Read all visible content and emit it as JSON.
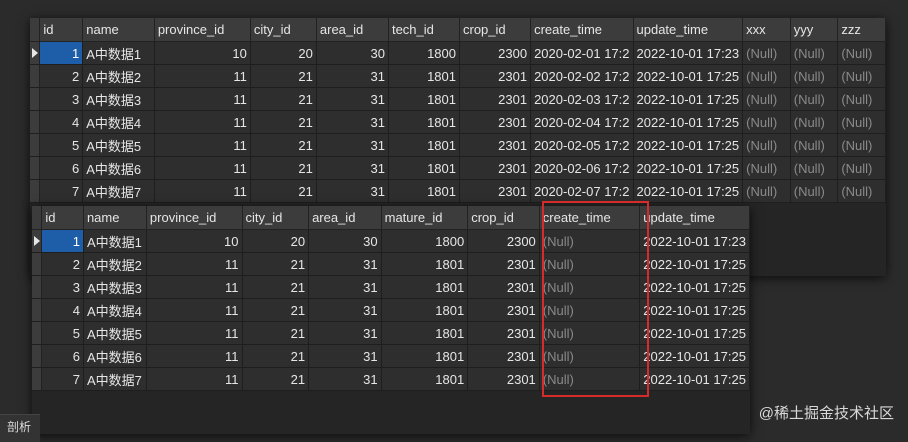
{
  "grid1": {
    "columns": [
      "id",
      "name",
      "province_id",
      "city_id",
      "area_id",
      "tech_id",
      "crop_id",
      "create_time",
      "update_time",
      "xxx",
      "yyy",
      "zzz"
    ],
    "rows": [
      [
        "1",
        "A中数据1",
        "10",
        "20",
        "30",
        "1800",
        "2300",
        "2020-02-01 17:2",
        "2022-10-01 17:23",
        "(Null)",
        "(Null)",
        "(Null)"
      ],
      [
        "2",
        "A中数据2",
        "11",
        "21",
        "31",
        "1801",
        "2301",
        "2020-02-02 17:2",
        "2022-10-01 17:25",
        "(Null)",
        "(Null)",
        "(Null)"
      ],
      [
        "3",
        "A中数据3",
        "11",
        "21",
        "31",
        "1801",
        "2301",
        "2020-02-03 17:2",
        "2022-10-01 17:25",
        "(Null)",
        "(Null)",
        "(Null)"
      ],
      [
        "4",
        "A中数据4",
        "11",
        "21",
        "31",
        "1801",
        "2301",
        "2020-02-04 17:2",
        "2022-10-01 17:25",
        "(Null)",
        "(Null)",
        "(Null)"
      ],
      [
        "5",
        "A中数据5",
        "11",
        "21",
        "31",
        "1801",
        "2301",
        "2020-02-05 17:2",
        "2022-10-01 17:25",
        "(Null)",
        "(Null)",
        "(Null)"
      ],
      [
        "6",
        "A中数据6",
        "11",
        "21",
        "31",
        "1801",
        "2301",
        "2020-02-06 17:2",
        "2022-10-01 17:25",
        "(Null)",
        "(Null)",
        "(Null)"
      ],
      [
        "7",
        "A中数据7",
        "11",
        "21",
        "31",
        "1801",
        "2301",
        "2020-02-07 17:2",
        "2022-10-01 17:25",
        "(Null)",
        "(Null)",
        "(Null)"
      ]
    ]
  },
  "grid2": {
    "columns": [
      "id",
      "name",
      "province_id",
      "city_id",
      "area_id",
      "mature_id",
      "crop_id",
      "create_time",
      "update_time"
    ],
    "rows": [
      [
        "1",
        "A中数据1",
        "10",
        "20",
        "30",
        "1800",
        "2300",
        "(Null)",
        "2022-10-01 17:23"
      ],
      [
        "2",
        "A中数据2",
        "11",
        "21",
        "31",
        "1801",
        "2301",
        "(Null)",
        "2022-10-01 17:25"
      ],
      [
        "3",
        "A中数据3",
        "11",
        "21",
        "31",
        "1801",
        "2301",
        "(Null)",
        "2022-10-01 17:25"
      ],
      [
        "4",
        "A中数据4",
        "11",
        "21",
        "31",
        "1801",
        "2301",
        "(Null)",
        "2022-10-01 17:25"
      ],
      [
        "5",
        "A中数据5",
        "11",
        "21",
        "31",
        "1801",
        "2301",
        "(Null)",
        "2022-10-01 17:25"
      ],
      [
        "6",
        "A中数据6",
        "11",
        "21",
        "31",
        "1801",
        "2301",
        "(Null)",
        "2022-10-01 17:25"
      ],
      [
        "7",
        "A中数据7",
        "11",
        "21",
        "31",
        "1801",
        "2301",
        "(Null)",
        "2022-10-01 17:25"
      ]
    ]
  },
  "footer": {
    "tab_label": "剖析"
  },
  "watermark": "@稀土掘金技术社区",
  "colors": {
    "selection": "#1e5ea8",
    "highlight_box": "#d62b2b",
    "null_text": "#8a8a8a"
  }
}
